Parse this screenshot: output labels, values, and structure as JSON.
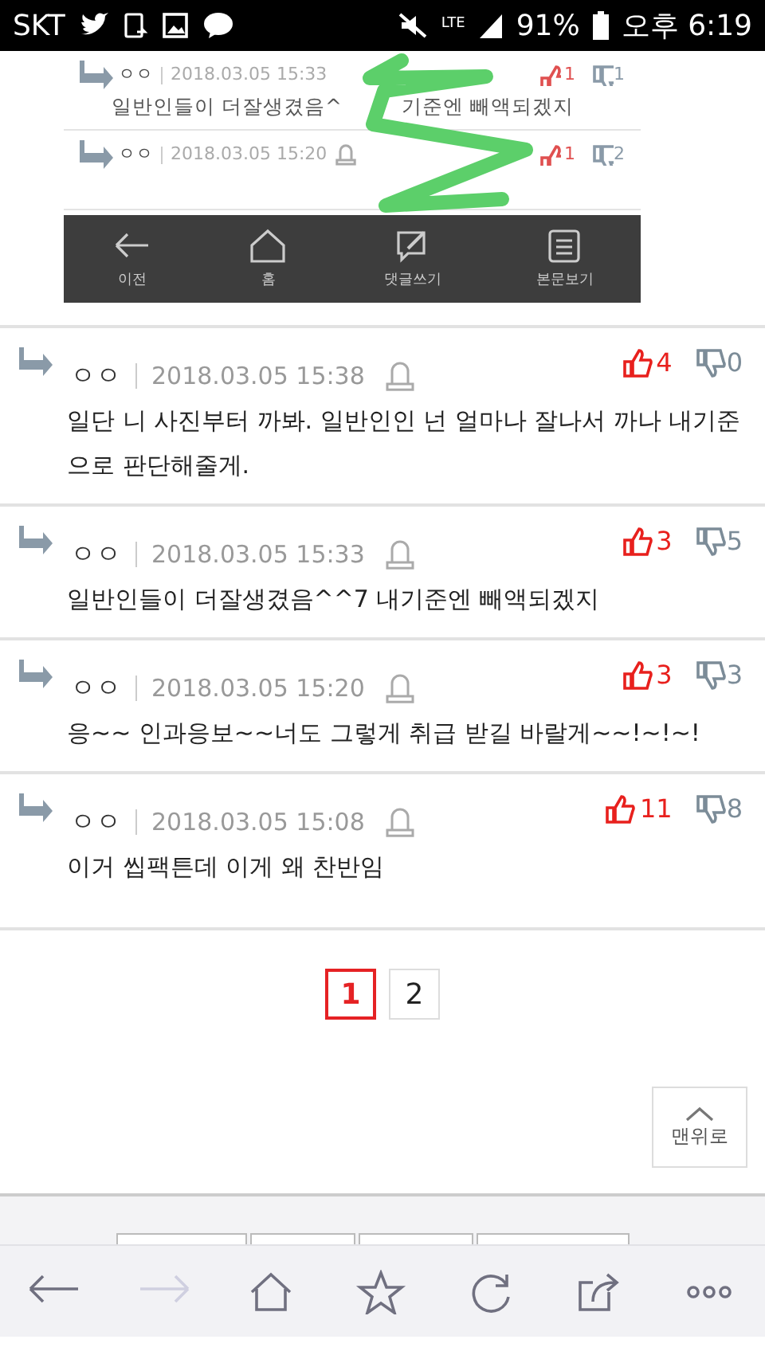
{
  "status_bar": {
    "carrier": "SKT",
    "network": "LTE",
    "battery": "91%",
    "time": "오후 6:19"
  },
  "embedded_screenshot": {
    "comments": [
      {
        "name": "ㅇㅇ",
        "date": "2018.03.05 15:33",
        "likes": "1",
        "dislikes": "1",
        "text_parts": [
          "일반인들이 더잘생겼음^",
          "기준엔 빼액되겠지"
        ]
      },
      {
        "name": "ㅇㅇ",
        "date": "2018.03.05 15:20",
        "likes": "1",
        "dislikes": "2"
      }
    ],
    "toolbar": [
      {
        "kind": "back",
        "label": "이전"
      },
      {
        "kind": "home",
        "label": "홈"
      },
      {
        "kind": "write",
        "label": "댓글쓰기"
      },
      {
        "kind": "doc",
        "label": "본문보기"
      }
    ]
  },
  "comments": [
    {
      "name": "ㅇㅇ",
      "date": "2018.03.05 15:38",
      "likes": "4",
      "dislikes": "0",
      "text": "일단 니 사진부터 까봐. 일반인인 넌 얼마나 잘나서 까나 내기준으로 판단해줄게."
    },
    {
      "name": "ㅇㅇ",
      "date": "2018.03.05 15:33",
      "likes": "3",
      "dislikes": "5",
      "text": "일반인들이 더잘생겼음^^7 내기준엔 빼액되겠지"
    },
    {
      "name": "ㅇㅇ",
      "date": "2018.03.05 15:20",
      "likes": "3",
      "dislikes": "3",
      "text": "응~~ 인과응보~~너도 그렇게 취급 받길 바랄게~~!~!~!"
    },
    {
      "name": "ㅇㅇ",
      "date": "2018.03.05 15:08",
      "likes": "11",
      "dislikes": "8",
      "text": "이거 씹팩튼데 이게 왜 찬반임"
    }
  ],
  "pagination": [
    {
      "label": "1",
      "selected": true
    },
    {
      "label": "2",
      "selected": false
    }
  ],
  "top_button": "맨위로",
  "browser_toolbar": [
    {
      "kind": "back",
      "disabled": false
    },
    {
      "kind": "forward",
      "disabled": true
    },
    {
      "kind": "home",
      "disabled": false
    },
    {
      "kind": "star",
      "disabled": false
    },
    {
      "kind": "refresh",
      "disabled": false
    },
    {
      "kind": "share",
      "disabled": false
    },
    {
      "kind": "more",
      "disabled": false
    }
  ]
}
